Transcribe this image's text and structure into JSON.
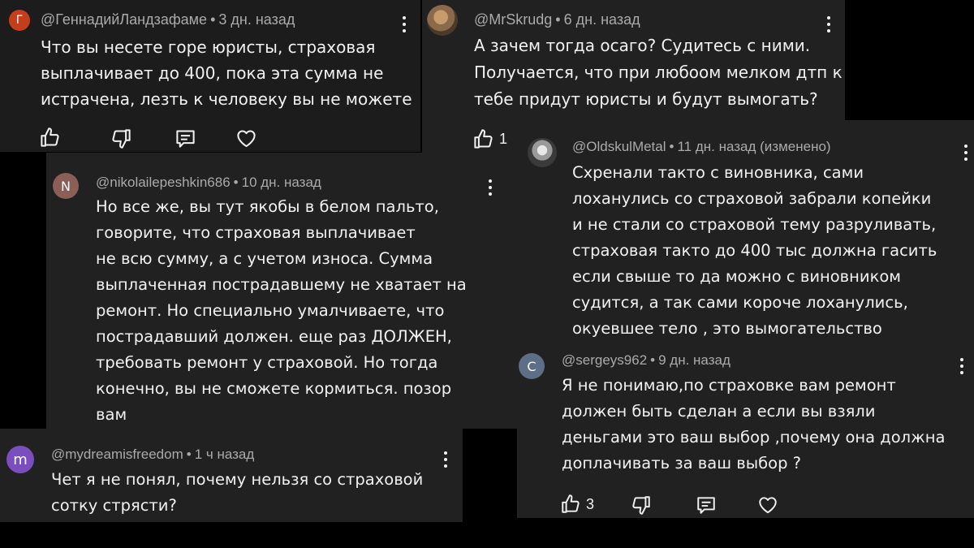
{
  "comments": {
    "c1": {
      "avatar_letter": "Г",
      "avatar_color": "#c43e1c",
      "author": "@ГеннадийЛандзафаме",
      "time": "3 дн. назад",
      "lines": [
        "Что вы несете горе юристы, страховая",
        "выплачивает до 400, пока эта сумма не",
        "истрачена, лезть к человеку вы не можете"
      ]
    },
    "c2": {
      "avatar_letter": "",
      "avatar_color": "#8a6a4a",
      "author": "@MrSkrudg",
      "time": "6 дн. назад",
      "lines": [
        "А зачем тогда осаго? Судитесь с ними.",
        "Получается, что при любоом мелком дтп к",
        "тебе придут юристы и будут вымогать?"
      ],
      "likes": "1"
    },
    "c3": {
      "avatar_letter": "N",
      "avatar_color": "#8b5e57",
      "author": "@nikolailepeshkin686",
      "time": "10 дн. назад",
      "lines": [
        "Но все же, вы тут якобы в белом пальто,",
        "говорите, что страховая выплачивает",
        "не всю сумму, а с учетом износа. Сумма",
        "выплаченная пострадавшему не хватает на",
        "ремонт. Но специально умалчиваете, что",
        "пострадавший должен. еще раз ДОЛЖЕН,",
        "требовать ремонт у страховой. Но тогда",
        "конечно, вы не сможете кормиться. позор",
        "вам"
      ]
    },
    "c4": {
      "avatar_letter": "",
      "avatar_color": "#b9b9b9",
      "author": "@OldskulMetal",
      "time": "11 дн. назад (изменено)",
      "lines": [
        "Схренали такто с виновника, сами",
        "лоханулись со страховой забрали копейки",
        "и не стали со страховой тему разруливать,",
        "страховая такто до 400 тыс должна гасить",
        "если свыше то да можно с виновником",
        "судится, а так сами короче лоханулись,",
        "окуевшее тело , это вымогательство"
      ]
    },
    "c5": {
      "avatar_letter": "C",
      "avatar_color": "#5c6f86",
      "author": "@sergeys962",
      "time": "9 дн. назад",
      "lines": [
        "Я не понимаю,по страховке вам ремонт",
        "должен быть сделан а если вы взяли",
        "деньгами это ваш выбор ,почему она должна",
        "доплачивать за ваш выбор ?"
      ],
      "likes": "3"
    },
    "c6": {
      "avatar_letter": "m",
      "avatar_color": "#7c4dbd",
      "author": "@mydreamisfreedom",
      "time": "1 ч назад",
      "lines": [
        "Чет я не понял, почему нельзя со страховой",
        "сотку стрясти?"
      ]
    }
  }
}
